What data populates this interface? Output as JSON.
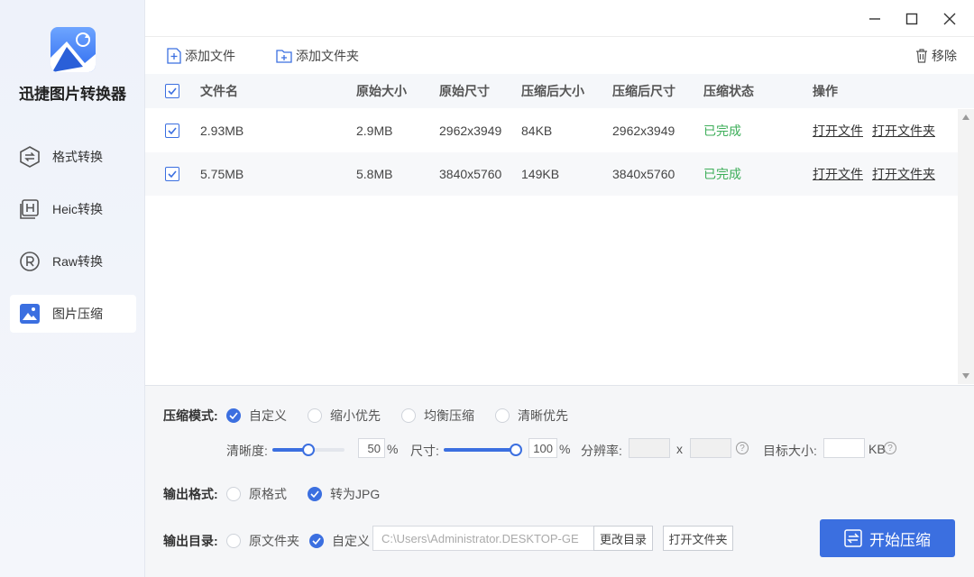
{
  "app": {
    "title": "迅捷图片转换器"
  },
  "sidebar": {
    "items": [
      {
        "label": "格式转换"
      },
      {
        "label": "Heic转换"
      },
      {
        "label": "Raw转换"
      },
      {
        "label": "图片压缩"
      }
    ],
    "active_index": 3
  },
  "toolbar": {
    "add_file": "添加文件",
    "add_folder": "添加文件夹",
    "remove": "移除"
  },
  "table": {
    "columns": [
      "文件名",
      "原始大小",
      "原始尺寸",
      "压缩后大小",
      "压缩后尺寸",
      "压缩状态",
      "操作"
    ],
    "rows": [
      {
        "name": "2.93MB",
        "orig_size": "2.9MB",
        "orig_dim": "2962x3949",
        "new_size": "84KB",
        "new_dim": "2962x3949",
        "status": "已完成",
        "open_file": "打开文件",
        "open_folder": "打开文件夹"
      },
      {
        "name": "5.75MB",
        "orig_size": "5.8MB",
        "orig_dim": "3840x5760",
        "new_size": "149KB",
        "new_dim": "3840x5760",
        "status": "已完成",
        "open_file": "打开文件",
        "open_folder": "打开文件夹"
      }
    ]
  },
  "compress": {
    "mode_label": "压缩模式:",
    "modes": [
      "自定义",
      "缩小优先",
      "均衡压缩",
      "清晰优先"
    ],
    "mode_selected": 0,
    "clarity_label": "清晰度:",
    "clarity_value": "50",
    "clarity_fraction": 0.5,
    "size_label": "尺寸:",
    "size_value": "100",
    "size_fraction": 1.0,
    "percent": "%",
    "resolution_label": "分辨率:",
    "times": "x",
    "target_label": "目标大小:",
    "kb": "KB",
    "help": "?"
  },
  "output_format": {
    "label": "输出格式:",
    "options": [
      "原格式",
      "转为JPG"
    ],
    "selected": 1
  },
  "output_dir": {
    "label": "输出目录:",
    "options": [
      "原文件夹",
      "自定义"
    ],
    "selected": 1,
    "path": "C:\\Users\\Administrator.DESKTOP-GE",
    "change_btn": "更改目录",
    "open_btn": "打开文件夹"
  },
  "start_button": "开始压缩",
  "colors": {
    "accent": "#3b6fe0",
    "success": "#3dae59"
  }
}
